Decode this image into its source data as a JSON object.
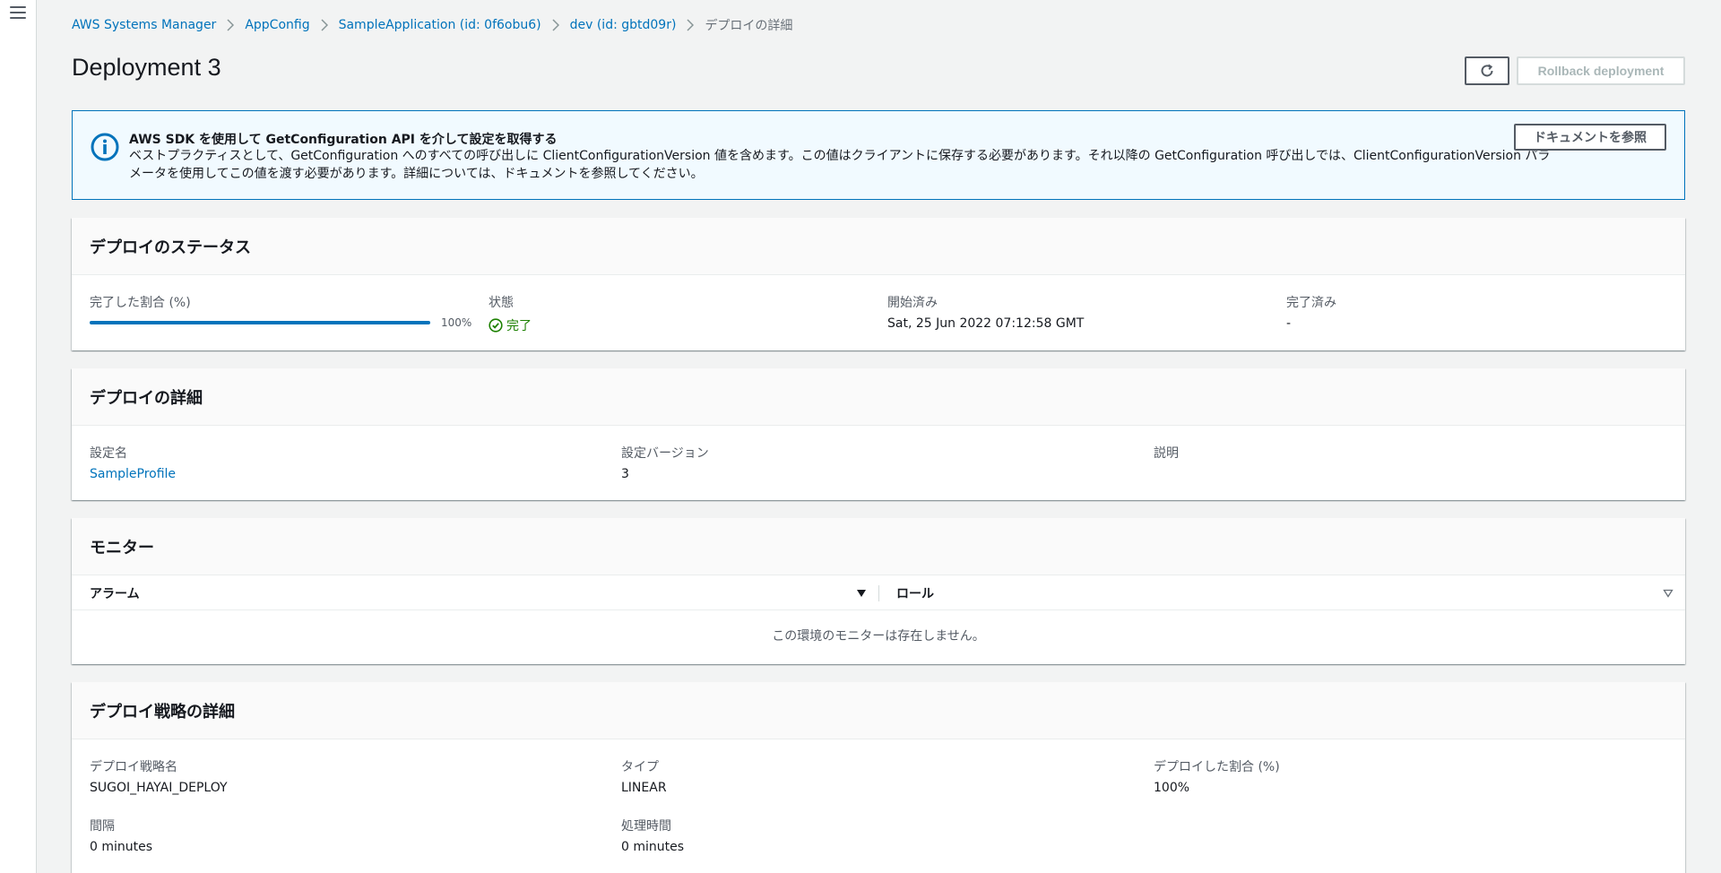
{
  "breadcrumb": [
    {
      "label": "AWS Systems Manager"
    },
    {
      "label": "AppConfig"
    },
    {
      "label": "SampleApplication (id: 0f6obu6)"
    },
    {
      "label": "dev (id: gbtd09r)"
    }
  ],
  "breadcrumb_current": "デプロイの詳細",
  "page_title": "Deployment 3",
  "actions": {
    "refresh_icon": "refresh-icon",
    "rollback_label": "Rollback deployment"
  },
  "flash": {
    "icon": "info-icon",
    "title": "AWS SDK を使用して GetConfiguration API を介して設定を取得する",
    "body": "ベストプラクティスとして、GetConfiguration へのすべての呼び出しに ClientConfigurationVersion 値を含めます。この値はクライアントに保存する必要があります。それ以降の GetConfiguration 呼び出しでは、ClientConfigurationVersion パラメータを使用してこの値を渡す必要があります。詳細については、ドキュメントを参照してください。",
    "action_label": "ドキュメントを参照"
  },
  "status_panel": {
    "title": "デプロイのステータス",
    "progress_label": "完了した割合 (%)",
    "progress_value": 100,
    "progress_text": "100%",
    "state_label": "状態",
    "state_value": "完了",
    "state_color": "#1d8102",
    "started_label": "開始済み",
    "started_value": "Sat, 25 Jun 2022 07:12:58 GMT",
    "completed_label": "完了済み",
    "completed_value": "-"
  },
  "details_panel": {
    "title": "デプロイの詳細",
    "config_name_label": "設定名",
    "config_name_value": "SampleProfile",
    "config_version_label": "設定バージョン",
    "config_version_value": "3",
    "description_label": "説明"
  },
  "monitor_panel": {
    "title": "モニター",
    "columns": [
      "アラーム",
      "ロール"
    ],
    "empty_text": "この環境のモニターは存在しません。"
  },
  "strategy_panel": {
    "title": "デプロイ戦略の詳細",
    "name_label": "デプロイ戦略名",
    "name_value": "SUGOI_HAYAI_DEPLOY",
    "type_label": "タイプ",
    "type_value": "LINEAR",
    "percent_label": "デプロイした割合 (%)",
    "percent_value": "100%",
    "interval_label": "間隔",
    "interval_value": "0 minutes",
    "duration_label": "処理時間",
    "duration_value": "0 minutes"
  },
  "colors": {
    "link": "#0073bb",
    "accent": "#0073bb",
    "success": "#1d8102"
  }
}
